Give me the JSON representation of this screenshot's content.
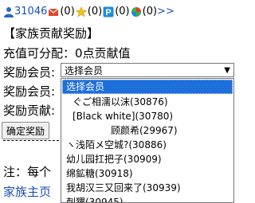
{
  "topbar": {
    "user_id": "31046",
    "count_a": "(0)",
    "count_b": "(0)",
    "count_c": "(0)",
    "count_d": "(0)",
    "more": ">>"
  },
  "page": {
    "title": "【家族贡献奖励】",
    "recharge_text": "充值可分配：0点贡献值",
    "label_member": "奖励会员:",
    "label_row2": "奖励会员:",
    "label_row3": "奖励贡献:",
    "confirm_button": "确定奖励",
    "note": "注：每个",
    "home_link": "家族主页"
  },
  "select": {
    "current": "选择会员",
    "options": [
      "选择会员",
      "ぐご相濡以沫(30876)",
      "[Black white](30780)",
      "顾颜希(29967)",
      "ヽ浅陌メ空城?(30886)",
      "幼儿园扛把子(30909)",
      "绵鉱糖(30918)",
      "我胡汉三又回来了(30939)",
      "刺猬(30945)"
    ]
  },
  "colors": {
    "link": "#1a4fb3",
    "selected_bg": "#1e6fdb"
  }
}
